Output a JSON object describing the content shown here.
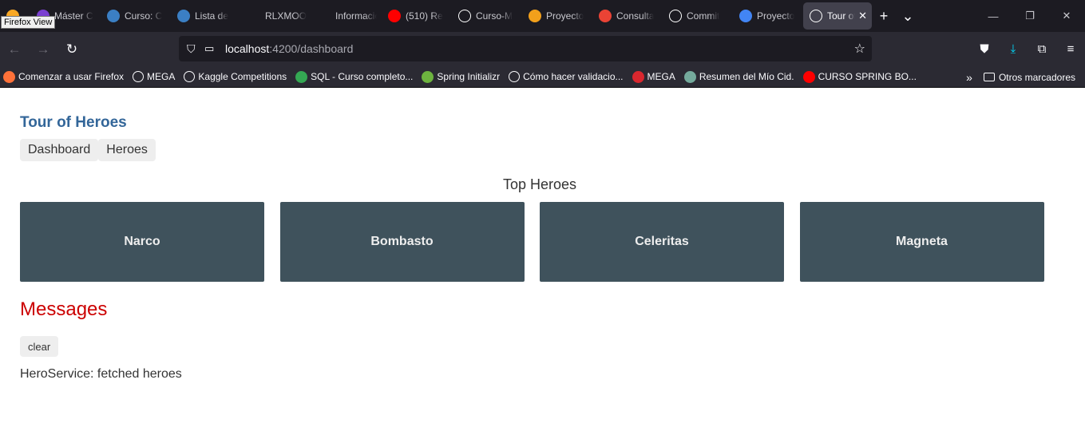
{
  "browser": {
    "tooltip": "Firefox View",
    "tabs": [
      {
        "label": "Máster C",
        "icon": "purple-circle-icon",
        "color": "#7a3fd1"
      },
      {
        "label": "Curso: C",
        "icon": "at-sign-icon",
        "color": "#3b7fc4"
      },
      {
        "label": "Lista de",
        "icon": "at-sign-icon",
        "color": "#3b7fc4"
      },
      {
        "label": "RLXMOOC",
        "icon": "",
        "color": ""
      },
      {
        "label": "Información",
        "icon": "",
        "color": ""
      },
      {
        "label": "(510) Re",
        "icon": "youtube-icon",
        "color": "#ff0000"
      },
      {
        "label": "Curso-M",
        "icon": "github-icon",
        "color": "#ffffff"
      },
      {
        "label": "Proyecto",
        "icon": "infinity-icon",
        "color": "#f2a01b"
      },
      {
        "label": "Consulta",
        "icon": "gmail-icon",
        "color": "#ea4335"
      },
      {
        "label": "Commit",
        "icon": "github-icon",
        "color": "#ffffff"
      },
      {
        "label": "Proyecto",
        "icon": "docs-icon",
        "color": "#4285f4"
      },
      {
        "label": "Tour of",
        "icon": "angular-icon",
        "color": "#ffffff",
        "active": true
      }
    ],
    "url_host": "localhost",
    "url_path": ":4200/dashboard",
    "bookmarks": [
      {
        "label": "Comenzar a usar Firefox",
        "icon": "firefox-icon",
        "color": "#ff7139"
      },
      {
        "label": "MEGA",
        "icon": "globe-icon",
        "color": ""
      },
      {
        "label": "Kaggle Competitions",
        "icon": "globe-icon",
        "color": ""
      },
      {
        "label": "SQL - Curso completo...",
        "icon": "google-drive-icon",
        "color": "#34a853"
      },
      {
        "label": "Spring Initializr",
        "icon": "spring-icon",
        "color": "#6db33f"
      },
      {
        "label": "Cómo hacer validacio...",
        "icon": "globe-icon",
        "color": ""
      },
      {
        "label": "MEGA",
        "icon": "mega-icon",
        "color": "#d9272e"
      },
      {
        "label": "Resumen del Mío Cid.",
        "icon": "chatgpt-icon",
        "color": "#74aa9c"
      },
      {
        "label": "CURSO SPRING BO...",
        "icon": "youtube-icon",
        "color": "#ff0000"
      }
    ],
    "other_bookmarks": "Otros marcadores"
  },
  "app": {
    "title": "Tour of Heroes",
    "nav": [
      "Dashboard",
      "Heroes"
    ],
    "top_heroes_title": "Top Heroes",
    "heroes": [
      "Narco",
      "Bombasto",
      "Celeritas",
      "Magneta"
    ],
    "messages_title": "Messages",
    "clear_label": "clear",
    "messages": [
      "HeroService: fetched heroes"
    ]
  },
  "colors": {
    "title": "#336699",
    "card_bg": "#3f525c",
    "messages_title": "#cc0000"
  }
}
